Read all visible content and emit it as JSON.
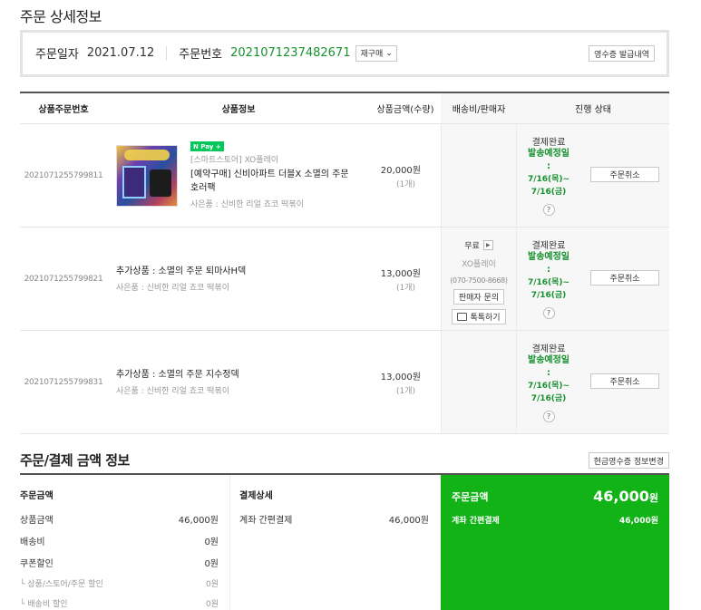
{
  "page_title": "주문 상세정보",
  "order": {
    "date_label": "주문일자",
    "date": "2021.07.12",
    "number_label": "주문번호",
    "number": "2021071237482671",
    "reorder_label": "재구매",
    "receipt_label": "영수증 발급내역"
  },
  "table": {
    "headers": [
      "상품주문번호",
      "상품정보",
      "상품금액(수량)",
      "배송비/판매자",
      "진행 상태"
    ],
    "rows": [
      {
        "id": "2021071255799811",
        "pay_badge": "N Pay +",
        "store": "[스마트스토어] XO플레이",
        "name": "[예약구매] 신비아파트 더블X 소멸의 주문 호러팩",
        "gift": "사은품 : 신비한 리얼 쵸코 떡볶이",
        "price": "20,000원",
        "qty": "(1개)",
        "status": "결제완료",
        "ship_label": "발송예정일",
        "colon": ":",
        "ship_dates": "7/16(목)~ 7/16(금)",
        "help": "?",
        "cancel": "주문취소"
      },
      {
        "id": "2021071255799821",
        "name": "추가상품 : 소멸의 주문 퇴마사H덱",
        "gift": "사은품 : 신비한 리얼 쵸코 떡볶이",
        "price": "13,000원",
        "qty": "(1개)",
        "status": "결제완료",
        "ship_label": "발송예정일",
        "colon": ":",
        "ship_dates": "7/16(목)~ 7/16(금)",
        "help": "?",
        "cancel": "주문취소"
      },
      {
        "id": "2021071255799831",
        "name": "추가상품 : 소멸의 주문 지수정덱",
        "gift": "사은품 : 신비한 리얼 쵸코 떡볶이",
        "price": "13,000원",
        "qty": "(1개)",
        "status": "결제완료",
        "ship_label": "발송예정일",
        "colon": ":",
        "ship_dates": "7/16(목)~ 7/16(금)",
        "help": "?",
        "cancel": "주문취소"
      }
    ],
    "shipping": {
      "fee": "무료",
      "seller": "XO플레이",
      "phone": "(070-7500-8668)",
      "inquiry": "판매자 문의",
      "talk": "톡톡하기"
    }
  },
  "payment": {
    "title": "주문/결제 금액 정보",
    "cash_receipt_label": "현금영수증 정보변경",
    "order_amount": {
      "heading": "주문금액",
      "rows": [
        {
          "label": "상품금액",
          "value": "46,000원"
        },
        {
          "label": "배송비",
          "value": "0원"
        },
        {
          "label": "쿠폰할인",
          "value": "0원"
        }
      ],
      "subrows": [
        {
          "label": "└ 상품/스토어/주문 할인",
          "value": "0원"
        },
        {
          "label": "└ 배송비 할인",
          "value": "0원"
        }
      ]
    },
    "details": {
      "heading": "결제상세",
      "method": "계좌 간편결제",
      "amount": "46,000원"
    },
    "total": {
      "label": "주문금액",
      "amount": "46,000",
      "unit": "원",
      "method": "계좌 간편결제",
      "method_amount": "46,000원"
    }
  },
  "colors": {
    "accent_green": "#16912e",
    "total_panel": "#12b317"
  }
}
